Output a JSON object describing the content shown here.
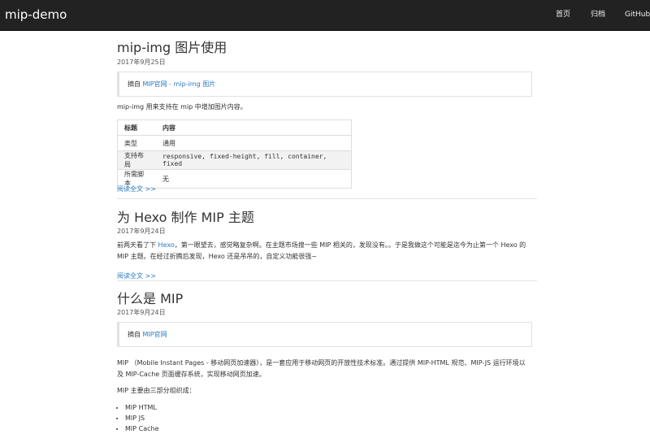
{
  "navbar": {
    "brand": "mip-demo",
    "links": [
      "首页",
      "归档",
      "GitHub"
    ]
  },
  "posts": [
    {
      "title": "mip-img 图片使用",
      "date": "2017年9月25日",
      "quote_prefix": "摘自 ",
      "quote_link": "MIP官网 - mip-img 图片",
      "desc": "mip-img 用来支持在 mip 中增加图片内容。",
      "table": {
        "headers": [
          "标题",
          "内容"
        ],
        "rows": [
          [
            "类型",
            "通用"
          ],
          [
            "支持布局",
            "responsive, fixed-height, fill, container, fixed"
          ],
          [
            "所需脚本",
            "无"
          ]
        ]
      },
      "read_more": "阅读全文 >>"
    },
    {
      "title": "为 Hexo 制作 MIP 主题",
      "date": "2017年9月24日",
      "text_before": "前两天看了下 ",
      "text_link": "Hexo",
      "text_after": "，第一眼望去，感觉略复杂啊。在主题市场搜一些 MIP 相关的，发现没有。。于是我做这个可能是迄今为止第一个 Hexo 的 MIP 主题。在经过折腾后发现，Hexo 还是吊吊的，自定义功能很强~",
      "read_more": "阅读全文 >>"
    },
    {
      "title": "什么是 MIP",
      "date": "2017年9月24日",
      "quote_prefix": "摘自 ",
      "quote_link": "MIP官网",
      "para1": "MIP （Mobile Instant Pages - 移动网页加速器），是一套应用于移动网页的开放性技术标准。通过提供 MIP-HTML 规范、MIP-JS 运行环境以及 MIP-Cache 页面缓存系统，实现移动网页加速。",
      "para2": "MIP 主要由三部分组织成：",
      "list": [
        "MIP HTML",
        "MIP JS",
        "MIP Cache"
      ]
    }
  ]
}
